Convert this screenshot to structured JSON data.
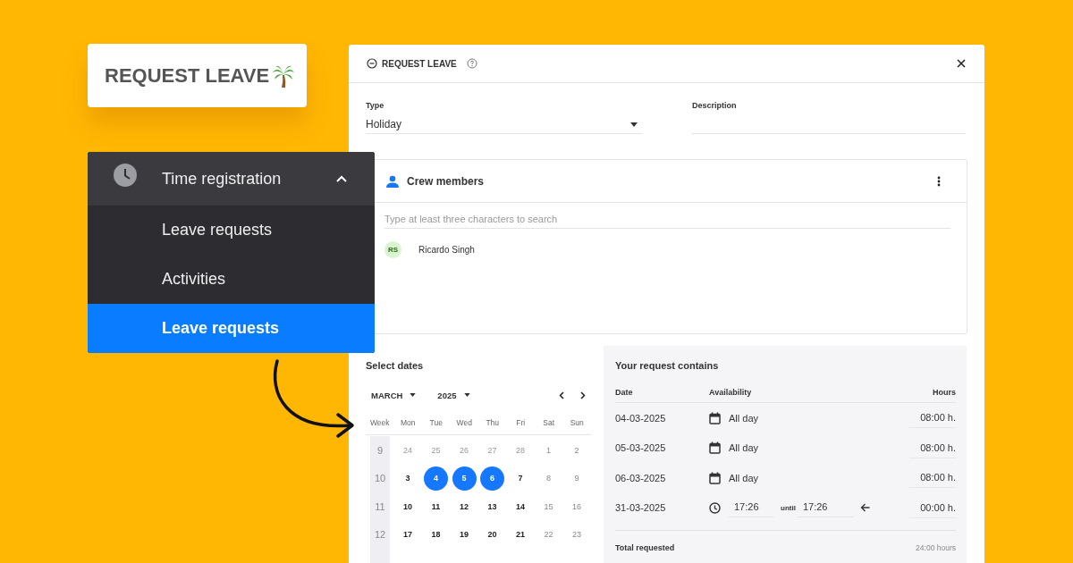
{
  "badge": {
    "title": "REQUEST LEAVE"
  },
  "menu": {
    "header": {
      "label": "Time registration",
      "expanded": true
    },
    "items": [
      {
        "label": "Leave requests",
        "selected": false
      },
      {
        "label": "Activities",
        "selected": false
      },
      {
        "label": "Leave requests",
        "selected": true
      }
    ]
  },
  "dialog": {
    "title": "REQUEST LEAVE",
    "fields": [
      {
        "label": "Type",
        "value": "Holiday",
        "kind": "dropdown"
      },
      {
        "label": "Description",
        "kind": "text"
      }
    ],
    "crew": {
      "title": "Crew members",
      "search": {
        "placeholder": "Type at least three characters to search"
      },
      "members": [
        {
          "initials": "RS",
          "name": "Ricardo Singh"
        }
      ]
    },
    "calendar": {
      "title": "Select dates",
      "month": "MARCH",
      "year": "2025",
      "week_header": "Week",
      "weekdays": [
        "Mon",
        "Tue",
        "Wed",
        "Thu",
        "Fri",
        "Sat",
        "Sun"
      ],
      "weeks": [
        {
          "number": "9",
          "days": [
            {
              "label": "24",
              "kind": "other_month",
              "selected": false
            },
            {
              "label": "25",
              "kind": "other_month",
              "selected": false
            },
            {
              "label": "26",
              "kind": "other_month",
              "selected": false
            },
            {
              "label": "27",
              "kind": "other_month",
              "selected": false
            },
            {
              "label": "28",
              "kind": "other_month",
              "selected": false
            },
            {
              "label": "1",
              "kind": "weekend",
              "selected": false
            },
            {
              "label": "2",
              "kind": "weekend",
              "selected": false
            }
          ]
        },
        {
          "number": "10",
          "days": [
            {
              "label": "3",
              "kind": "workday",
              "selected": false
            },
            {
              "label": "4",
              "kind": "workday",
              "selected": true
            },
            {
              "label": "5",
              "kind": "workday",
              "selected": true
            },
            {
              "label": "6",
              "kind": "workday",
              "selected": true
            },
            {
              "label": "7",
              "kind": "workday",
              "selected": false
            },
            {
              "label": "8",
              "kind": "weekend",
              "selected": false
            },
            {
              "label": "9",
              "kind": "weekend",
              "selected": false
            }
          ]
        },
        {
          "number": "11",
          "days": [
            {
              "label": "10",
              "kind": "workday",
              "selected": false
            },
            {
              "label": "11",
              "kind": "workday",
              "selected": false
            },
            {
              "label": "12",
              "kind": "workday",
              "selected": false
            },
            {
              "label": "13",
              "kind": "workday",
              "selected": false
            },
            {
              "label": "14",
              "kind": "workday",
              "selected": false
            },
            {
              "label": "15",
              "kind": "weekend",
              "selected": false
            },
            {
              "label": "16",
              "kind": "weekend",
              "selected": false
            }
          ]
        },
        {
          "number": "12",
          "days": [
            {
              "label": "17",
              "kind": "workday",
              "selected": false
            },
            {
              "label": "18",
              "kind": "workday",
              "selected": false
            },
            {
              "label": "19",
              "kind": "workday",
              "selected": false
            },
            {
              "label": "20",
              "kind": "workday",
              "selected": false
            },
            {
              "label": "21",
              "kind": "workday",
              "selected": false
            },
            {
              "label": "22",
              "kind": "weekend",
              "selected": false
            },
            {
              "label": "23",
              "kind": "weekend",
              "selected": false
            }
          ]
        }
      ]
    },
    "request": {
      "title": "Your request contains",
      "columns": [
        "Date",
        "Availability",
        "Hours"
      ],
      "rows": [
        {
          "date": "04-03-2025",
          "kind": "all_day",
          "availability": "All day",
          "hours": "08:00 h."
        },
        {
          "date": "05-03-2025",
          "kind": "all_day",
          "availability": "All day",
          "hours": "08:00 h."
        },
        {
          "date": "06-03-2025",
          "kind": "all_day",
          "availability": "All day",
          "hours": "08:00 h."
        },
        {
          "date": "31-03-2025",
          "kind": "time_range",
          "from": "17:26",
          "until_label": "until",
          "to": "17:26",
          "hours": "00:00 h."
        }
      ],
      "total": {
        "label": "Total requested",
        "value": "24:00 hours"
      }
    }
  }
}
